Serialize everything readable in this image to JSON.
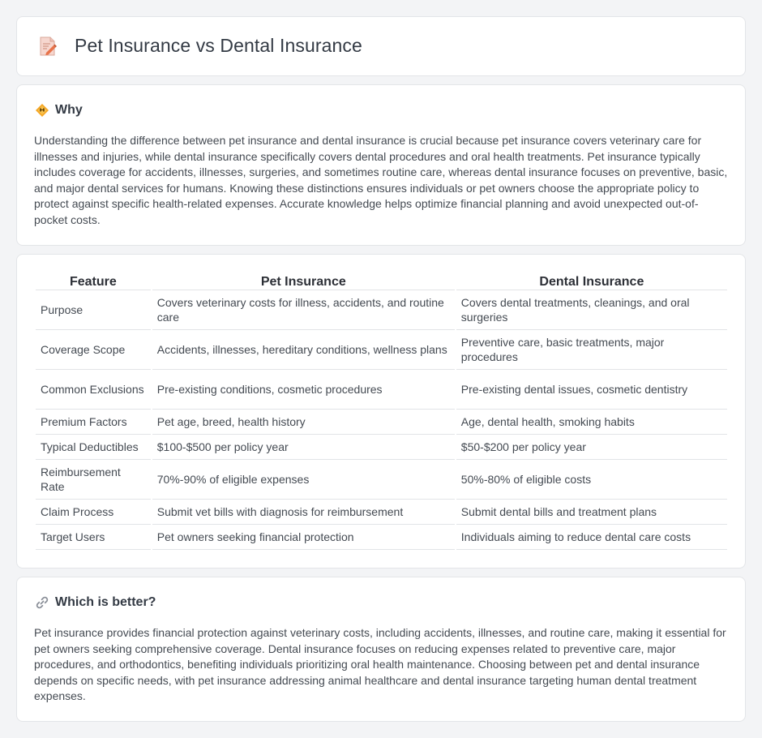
{
  "header": {
    "title": "Pet Insurance vs Dental Insurance",
    "icon": "document-pencil-icon"
  },
  "why": {
    "title": "Why",
    "icon": "diamond-warning-icon",
    "body": "Understanding the difference between pet insurance and dental insurance is crucial because pet insurance covers veterinary care for illnesses and injuries, while dental insurance specifically covers dental procedures and oral health treatments. Pet insurance typically includes coverage for accidents, illnesses, surgeries, and sometimes routine care, whereas dental insurance focuses on preventive, basic, and major dental services for humans. Knowing these distinctions ensures individuals or pet owners choose the appropriate policy to protect against specific health-related expenses. Accurate knowledge helps optimize financial planning and avoid unexpected out-of-pocket costs."
  },
  "table": {
    "headers": [
      "Feature",
      "Pet Insurance",
      "Dental Insurance"
    ],
    "rows": [
      [
        "Purpose",
        "Covers veterinary costs for illness, accidents, and routine care",
        "Covers dental treatments, cleanings, and oral surgeries"
      ],
      [
        "Coverage Scope",
        "Accidents, illnesses, hereditary conditions, wellness plans",
        "Preventive care, basic treatments, major procedures"
      ],
      [
        "Common Exclusions",
        "Pre-existing conditions, cosmetic procedures",
        "Pre-existing dental issues, cosmetic dentistry"
      ],
      [
        "Premium Factors",
        "Pet age, breed, health history",
        "Age, dental health, smoking habits"
      ],
      [
        "Typical Deductibles",
        "$100-$500 per policy year",
        "$50-$200 per policy year"
      ],
      [
        "Reimbursement Rate",
        "70%-90% of eligible expenses",
        "50%-80% of eligible costs"
      ],
      [
        "Claim Process",
        "Submit vet bills with diagnosis for reimbursement",
        "Submit dental bills and treatment plans"
      ],
      [
        "Target Users",
        "Pet owners seeking financial protection",
        "Individuals aiming to reduce dental care costs"
      ]
    ]
  },
  "better": {
    "title": "Which is better?",
    "icon": "link-icon",
    "body": "Pet insurance provides financial protection against veterinary costs, including accidents, illnesses, and routine care, making it essential for pet owners seeking comprehensive coverage. Dental insurance focuses on reducing expenses related to preventive care, major procedures, and orthodontics, benefiting individuals prioritizing oral health maintenance. Choosing between pet and dental insurance depends on specific needs, with pet insurance addressing animal healthcare and dental insurance targeting human dental treatment expenses."
  },
  "colors": {
    "background": "#f3f4f6",
    "card": "#ffffff",
    "border": "#e3e5e8",
    "warning_icon": "#f5a623",
    "doc_icon": "#e8734a"
  }
}
